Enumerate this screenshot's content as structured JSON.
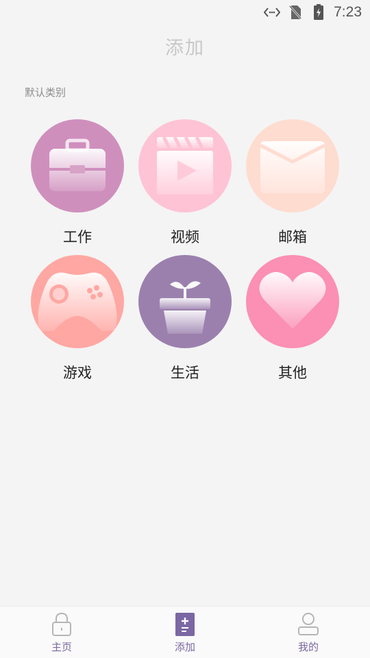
{
  "status_bar": {
    "time": "7:23"
  },
  "header": {
    "title": "添加"
  },
  "section": {
    "label": "默认类别"
  },
  "categories": [
    {
      "label": "工作",
      "icon": "briefcase-icon",
      "color": "#cf8fbd"
    },
    {
      "label": "视频",
      "icon": "video-icon",
      "color": "#ffc3d6"
    },
    {
      "label": "邮箱",
      "icon": "mail-icon",
      "color": "#ffdcd0"
    },
    {
      "label": "游戏",
      "icon": "gamepad-icon",
      "color": "#ffa7a2"
    },
    {
      "label": "生活",
      "icon": "plant-pot-icon",
      "color": "#9b80ae"
    },
    {
      "label": "其他",
      "icon": "heart-icon",
      "color": "#fb8fb4"
    }
  ],
  "bottom_nav": {
    "items": [
      {
        "label": "主页",
        "icon": "lock-icon"
      },
      {
        "label": "添加",
        "icon": "add-doc-icon",
        "active": true
      },
      {
        "label": "我的",
        "icon": "user-icon"
      }
    ],
    "accent": "#7b67a3"
  }
}
